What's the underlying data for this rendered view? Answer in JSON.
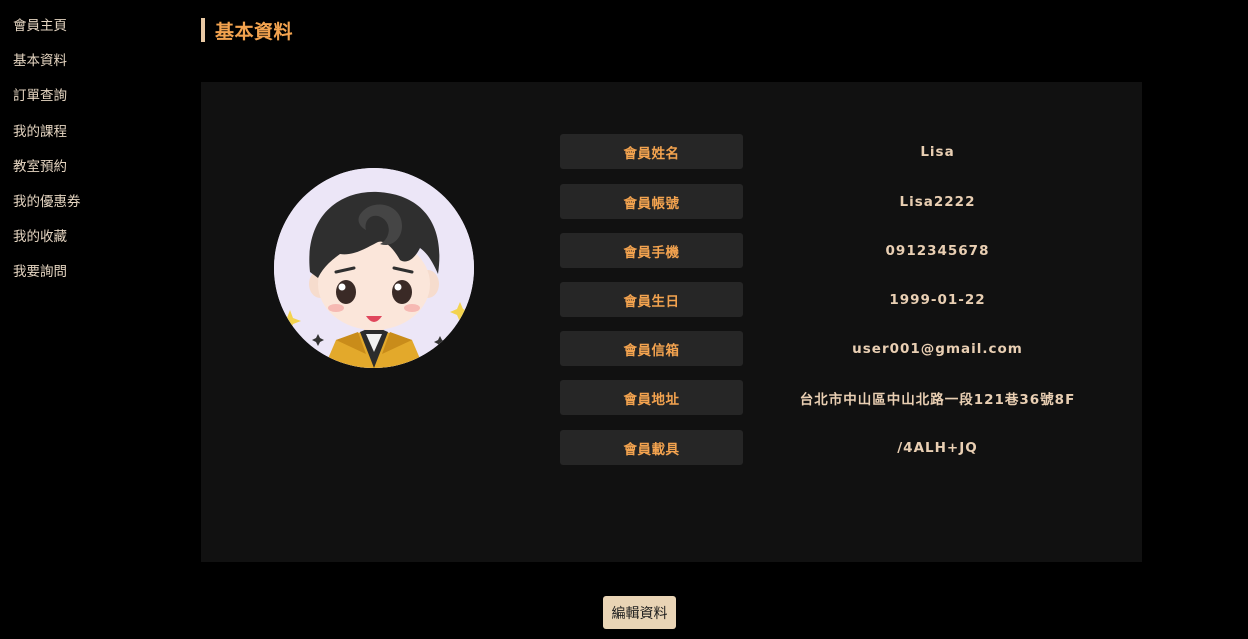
{
  "sidebar": {
    "items": [
      {
        "label": "會員主頁"
      },
      {
        "label": "基本資料"
      },
      {
        "label": "訂單查詢"
      },
      {
        "label": "我的課程"
      },
      {
        "label": "教室預約"
      },
      {
        "label": "我的優惠券"
      },
      {
        "label": "我的收藏"
      },
      {
        "label": "我要詢問"
      }
    ]
  },
  "main": {
    "title": "基本資料",
    "avatar": {
      "icon": "cartoon-boy-avatar"
    },
    "fields": [
      {
        "label": "會員姓名",
        "value": "Lisa"
      },
      {
        "label": "會員帳號",
        "value": "Lisa2222"
      },
      {
        "label": "會員手機",
        "value": "0912345678"
      },
      {
        "label": "會員生日",
        "value": "1999-01-22"
      },
      {
        "label": "會員信箱",
        "value": "user001@gmail.com"
      },
      {
        "label": "會員地址",
        "value": "台北市中山區中山北路一段121巷36號8F"
      },
      {
        "label": "會員載具",
        "value": "/4ALH+JQ"
      }
    ],
    "edit_button_label": "編輯資料"
  },
  "colors": {
    "background": "#000000",
    "card": "#111111",
    "accent": "#f3a34f",
    "label_bg": "#262626",
    "value_text": "#e9cfb3",
    "button_bg": "#e9d4b5"
  }
}
